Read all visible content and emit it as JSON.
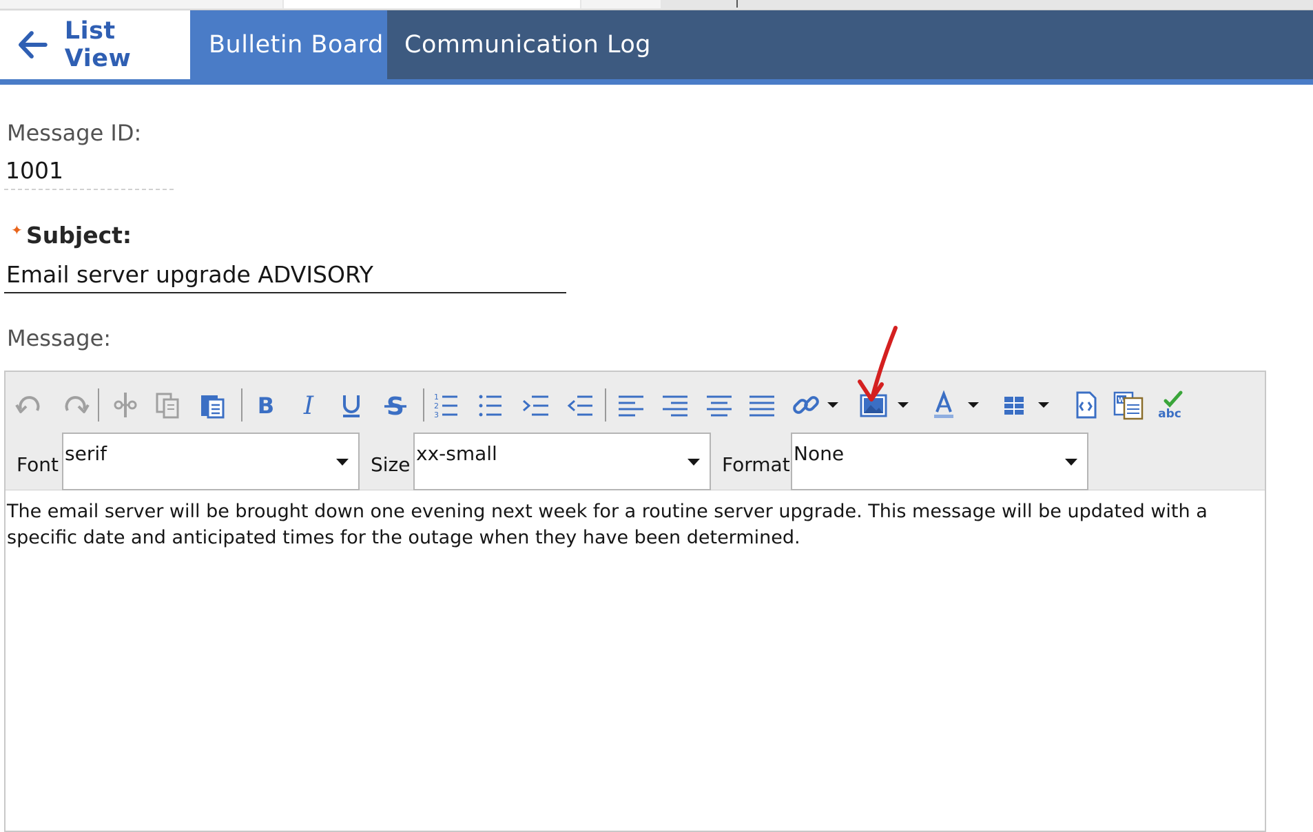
{
  "tabs": {
    "list_view": "List View",
    "bulletin_board": "Bulletin Board",
    "communication_log": "Communication Log"
  },
  "fields": {
    "message_id_label": "Message ID:",
    "message_id_value": "1001",
    "subject_label": "Subject:",
    "subject_value": "Email server upgrade ADVISORY",
    "message_label": "Message:"
  },
  "toolbar": {
    "icons": [
      "undo-icon",
      "redo-icon",
      "cut-icon",
      "copy-icon",
      "paste-icon",
      "bold-icon",
      "italic-icon",
      "underline-icon",
      "strikethrough-icon",
      "ordered-list-icon",
      "unordered-list-icon",
      "indent-icon",
      "outdent-icon",
      "align-left-icon",
      "align-right-icon",
      "align-center-icon",
      "justify-icon",
      "link-icon",
      "image-icon",
      "font-color-icon",
      "table-icon",
      "html-source-icon",
      "paste-from-word-icon",
      "spellcheck-icon"
    ],
    "font_label": "Font",
    "font_value": "serif",
    "size_label": "Size",
    "size_value": "xx-small",
    "format_label": "Format",
    "format_value": "None"
  },
  "editor": {
    "body_text": "The email server will be brought down one evening next week for a routine server upgrade. This message will be updated with a specific date and anticipated times for the outage when they have been determined."
  },
  "colors": {
    "tab_bar": "#3d5a80",
    "active_tab": "#4a7cc7",
    "link_blue": "#2f5fb3",
    "icon_blue": "#3b6fc4",
    "required_star": "#e8641b",
    "annotation_red": "#d42020"
  }
}
